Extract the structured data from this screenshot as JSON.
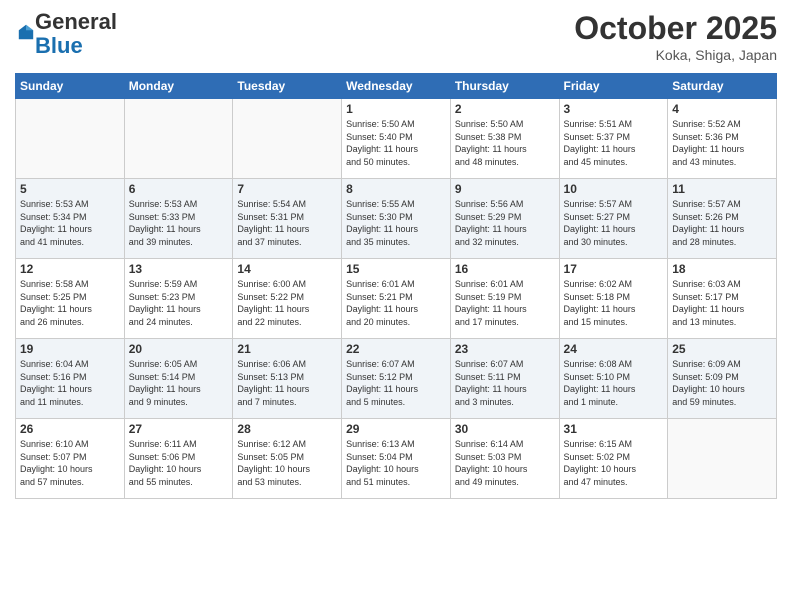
{
  "header": {
    "logo_general": "General",
    "logo_blue": "Blue",
    "month_title": "October 2025",
    "location": "Koka, Shiga, Japan"
  },
  "weekdays": [
    "Sunday",
    "Monday",
    "Tuesday",
    "Wednesday",
    "Thursday",
    "Friday",
    "Saturday"
  ],
  "weeks": [
    [
      {
        "day": "",
        "info": ""
      },
      {
        "day": "",
        "info": ""
      },
      {
        "day": "",
        "info": ""
      },
      {
        "day": "1",
        "info": "Sunrise: 5:50 AM\nSunset: 5:40 PM\nDaylight: 11 hours\nand 50 minutes."
      },
      {
        "day": "2",
        "info": "Sunrise: 5:50 AM\nSunset: 5:38 PM\nDaylight: 11 hours\nand 48 minutes."
      },
      {
        "day": "3",
        "info": "Sunrise: 5:51 AM\nSunset: 5:37 PM\nDaylight: 11 hours\nand 45 minutes."
      },
      {
        "day": "4",
        "info": "Sunrise: 5:52 AM\nSunset: 5:36 PM\nDaylight: 11 hours\nand 43 minutes."
      }
    ],
    [
      {
        "day": "5",
        "info": "Sunrise: 5:53 AM\nSunset: 5:34 PM\nDaylight: 11 hours\nand 41 minutes."
      },
      {
        "day": "6",
        "info": "Sunrise: 5:53 AM\nSunset: 5:33 PM\nDaylight: 11 hours\nand 39 minutes."
      },
      {
        "day": "7",
        "info": "Sunrise: 5:54 AM\nSunset: 5:31 PM\nDaylight: 11 hours\nand 37 minutes."
      },
      {
        "day": "8",
        "info": "Sunrise: 5:55 AM\nSunset: 5:30 PM\nDaylight: 11 hours\nand 35 minutes."
      },
      {
        "day": "9",
        "info": "Sunrise: 5:56 AM\nSunset: 5:29 PM\nDaylight: 11 hours\nand 32 minutes."
      },
      {
        "day": "10",
        "info": "Sunrise: 5:57 AM\nSunset: 5:27 PM\nDaylight: 11 hours\nand 30 minutes."
      },
      {
        "day": "11",
        "info": "Sunrise: 5:57 AM\nSunset: 5:26 PM\nDaylight: 11 hours\nand 28 minutes."
      }
    ],
    [
      {
        "day": "12",
        "info": "Sunrise: 5:58 AM\nSunset: 5:25 PM\nDaylight: 11 hours\nand 26 minutes."
      },
      {
        "day": "13",
        "info": "Sunrise: 5:59 AM\nSunset: 5:23 PM\nDaylight: 11 hours\nand 24 minutes."
      },
      {
        "day": "14",
        "info": "Sunrise: 6:00 AM\nSunset: 5:22 PM\nDaylight: 11 hours\nand 22 minutes."
      },
      {
        "day": "15",
        "info": "Sunrise: 6:01 AM\nSunset: 5:21 PM\nDaylight: 11 hours\nand 20 minutes."
      },
      {
        "day": "16",
        "info": "Sunrise: 6:01 AM\nSunset: 5:19 PM\nDaylight: 11 hours\nand 17 minutes."
      },
      {
        "day": "17",
        "info": "Sunrise: 6:02 AM\nSunset: 5:18 PM\nDaylight: 11 hours\nand 15 minutes."
      },
      {
        "day": "18",
        "info": "Sunrise: 6:03 AM\nSunset: 5:17 PM\nDaylight: 11 hours\nand 13 minutes."
      }
    ],
    [
      {
        "day": "19",
        "info": "Sunrise: 6:04 AM\nSunset: 5:16 PM\nDaylight: 11 hours\nand 11 minutes."
      },
      {
        "day": "20",
        "info": "Sunrise: 6:05 AM\nSunset: 5:14 PM\nDaylight: 11 hours\nand 9 minutes."
      },
      {
        "day": "21",
        "info": "Sunrise: 6:06 AM\nSunset: 5:13 PM\nDaylight: 11 hours\nand 7 minutes."
      },
      {
        "day": "22",
        "info": "Sunrise: 6:07 AM\nSunset: 5:12 PM\nDaylight: 11 hours\nand 5 minutes."
      },
      {
        "day": "23",
        "info": "Sunrise: 6:07 AM\nSunset: 5:11 PM\nDaylight: 11 hours\nand 3 minutes."
      },
      {
        "day": "24",
        "info": "Sunrise: 6:08 AM\nSunset: 5:10 PM\nDaylight: 11 hours\nand 1 minute."
      },
      {
        "day": "25",
        "info": "Sunrise: 6:09 AM\nSunset: 5:09 PM\nDaylight: 10 hours\nand 59 minutes."
      }
    ],
    [
      {
        "day": "26",
        "info": "Sunrise: 6:10 AM\nSunset: 5:07 PM\nDaylight: 10 hours\nand 57 minutes."
      },
      {
        "day": "27",
        "info": "Sunrise: 6:11 AM\nSunset: 5:06 PM\nDaylight: 10 hours\nand 55 minutes."
      },
      {
        "day": "28",
        "info": "Sunrise: 6:12 AM\nSunset: 5:05 PM\nDaylight: 10 hours\nand 53 minutes."
      },
      {
        "day": "29",
        "info": "Sunrise: 6:13 AM\nSunset: 5:04 PM\nDaylight: 10 hours\nand 51 minutes."
      },
      {
        "day": "30",
        "info": "Sunrise: 6:14 AM\nSunset: 5:03 PM\nDaylight: 10 hours\nand 49 minutes."
      },
      {
        "day": "31",
        "info": "Sunrise: 6:15 AM\nSunset: 5:02 PM\nDaylight: 10 hours\nand 47 minutes."
      },
      {
        "day": "",
        "info": ""
      }
    ]
  ]
}
